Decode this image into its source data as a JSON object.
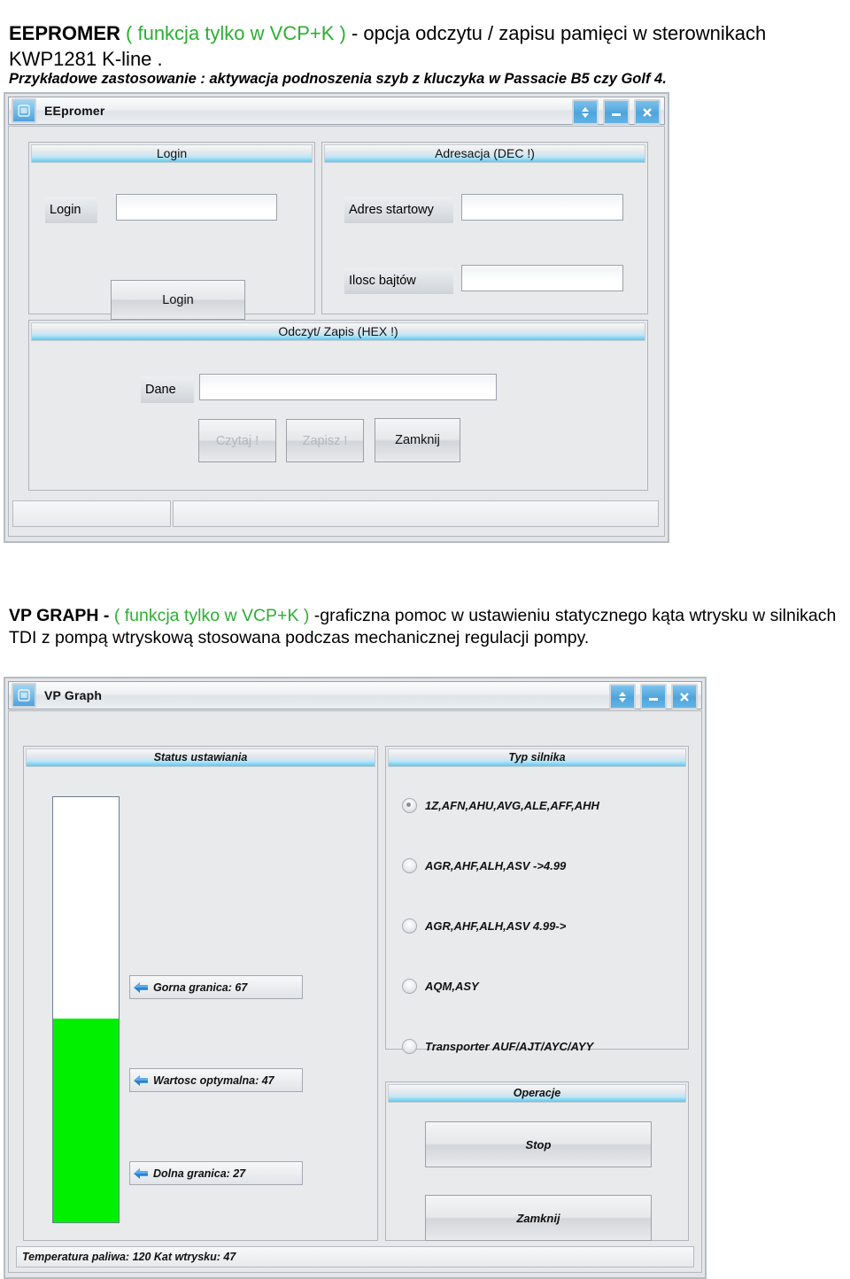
{
  "doc": {
    "para_eepromer": {
      "bold_lead": "EEPROMER",
      "green": " ( funkcja tylko w VCP+K ) ",
      "rest": "- opcja odczytu / zapisu pamięci w sterownikach KWP1281 K-line ."
    },
    "para_example": "Przykładowe zastosowanie : aktywacja podnoszenia szyb z kluczyka w Passacie B5 czy Golf 4.",
    "para_vpgraph": {
      "bold_lead": "VP GRAPH - ",
      "green": "( funkcja tylko w VCP+K )",
      "rest": " -graficzna pomoc w ustawieniu statycznego kąta wtrysku w silnikach TDI z pompą wtryskową stosowana podczas mechanicznej regulacji pompy."
    }
  },
  "eepromer_window": {
    "title": "EEpromer",
    "icon": "app-menu-icon",
    "title_buttons": [
      {
        "name": "restore-button",
        "glyph": "up-down-arrows-icon"
      },
      {
        "name": "minimize-button",
        "glyph": "minus-icon"
      },
      {
        "name": "close-button",
        "glyph": "x-icon"
      }
    ],
    "groups": {
      "login": {
        "header": "Login",
        "label_login": "Login",
        "input_login_value": "",
        "button_login": "Login"
      },
      "adresacja": {
        "header": "Adresacja (DEC !)",
        "label_adres_startowy": "Adres startowy",
        "input_adres_startowy_value": "",
        "label_ilosc_bajtow": "Ilosc bajtów",
        "input_ilosc_bajtow_value": ""
      },
      "odczyt_zapis": {
        "header": "Odczyt/ Zapis (HEX !)",
        "label_dane": "Dane",
        "input_dane_value": "",
        "button_czytaj": "Czytaj !",
        "button_zapisz": "Zapisz !",
        "button_zamknij": "Zamknij"
      }
    },
    "statusbar": {
      "pane1": "",
      "pane2": ""
    }
  },
  "vpgraph_window": {
    "title": "VP Graph",
    "icon": "app-menu-icon",
    "title_buttons": [
      {
        "name": "restore-button",
        "glyph": "up-down-arrows-icon"
      },
      {
        "name": "minimize-button",
        "glyph": "minus-icon"
      },
      {
        "name": "close-button",
        "glyph": "x-icon"
      }
    ],
    "status_group": {
      "header": "Status ustawiania",
      "markers": [
        {
          "name": "upper-limit-marker",
          "label": "Gorna granica: 67",
          "value": 67
        },
        {
          "name": "optimal-value-marker",
          "label": "Wartosc optymalna: 47",
          "value": 47
        },
        {
          "name": "lower-limit-marker",
          "label": "Dolna granica: 27",
          "value": 27
        }
      ],
      "gauge": {
        "fill_color": "#00f000",
        "fill_percent": 48
      }
    },
    "engine_group": {
      "header": "Typ silnika",
      "options": [
        {
          "label": "1Z,AFN,AHU,AVG,ALE,AFF,AHH",
          "selected": true
        },
        {
          "label": "AGR,AHF,ALH,ASV ->4.99",
          "selected": false
        },
        {
          "label": "AGR,AHF,ALH,ASV 4.99->",
          "selected": false
        },
        {
          "label": "AQM,ASY",
          "selected": false
        },
        {
          "label": "Transporter AUF/AJT/AYC/AYY",
          "selected": false
        }
      ]
    },
    "operations_group": {
      "header": "Operacje",
      "button_stop": "Stop",
      "button_zamknij": "Zamknij"
    },
    "statusbar": {
      "text": "Temperatura paliwa: 120 Kat wtrysku: 47"
    }
  },
  "colors": {
    "accent_green_text": "#2bb032",
    "gauge_green": "#00f000",
    "group_header_cyan": "#5cc8ee",
    "title_button_blue": "#4ea4dc"
  }
}
